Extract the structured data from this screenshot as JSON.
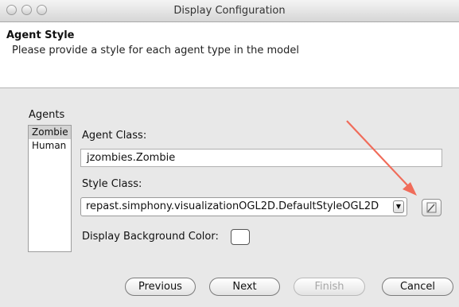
{
  "window": {
    "title": "Display Configuration"
  },
  "header": {
    "title": "Agent Style",
    "description": "Please provide a style for each agent type in the model"
  },
  "agents": {
    "label": "Agents",
    "items": [
      "Zombie",
      "Human"
    ],
    "selected": "Zombie"
  },
  "form": {
    "agent_class_label": "Agent Class:",
    "agent_class_value": "jzombies.Zombie",
    "style_class_label": "Style Class:",
    "style_class_value": "repast.simphony.visualizationOGL2D.DefaultStyleOGL2D",
    "background_color_label": "Display Background Color:"
  },
  "buttons": {
    "previous": "Previous",
    "next": "Next",
    "finish": "Finish",
    "cancel": "Cancel"
  },
  "colors": {
    "annotation_arrow": "#f06c5a",
    "selected_row": "#d3d3d3"
  },
  "icons": {
    "edit_button": "pencil-edit-icon",
    "dropdown": "chevron-down-icon"
  }
}
